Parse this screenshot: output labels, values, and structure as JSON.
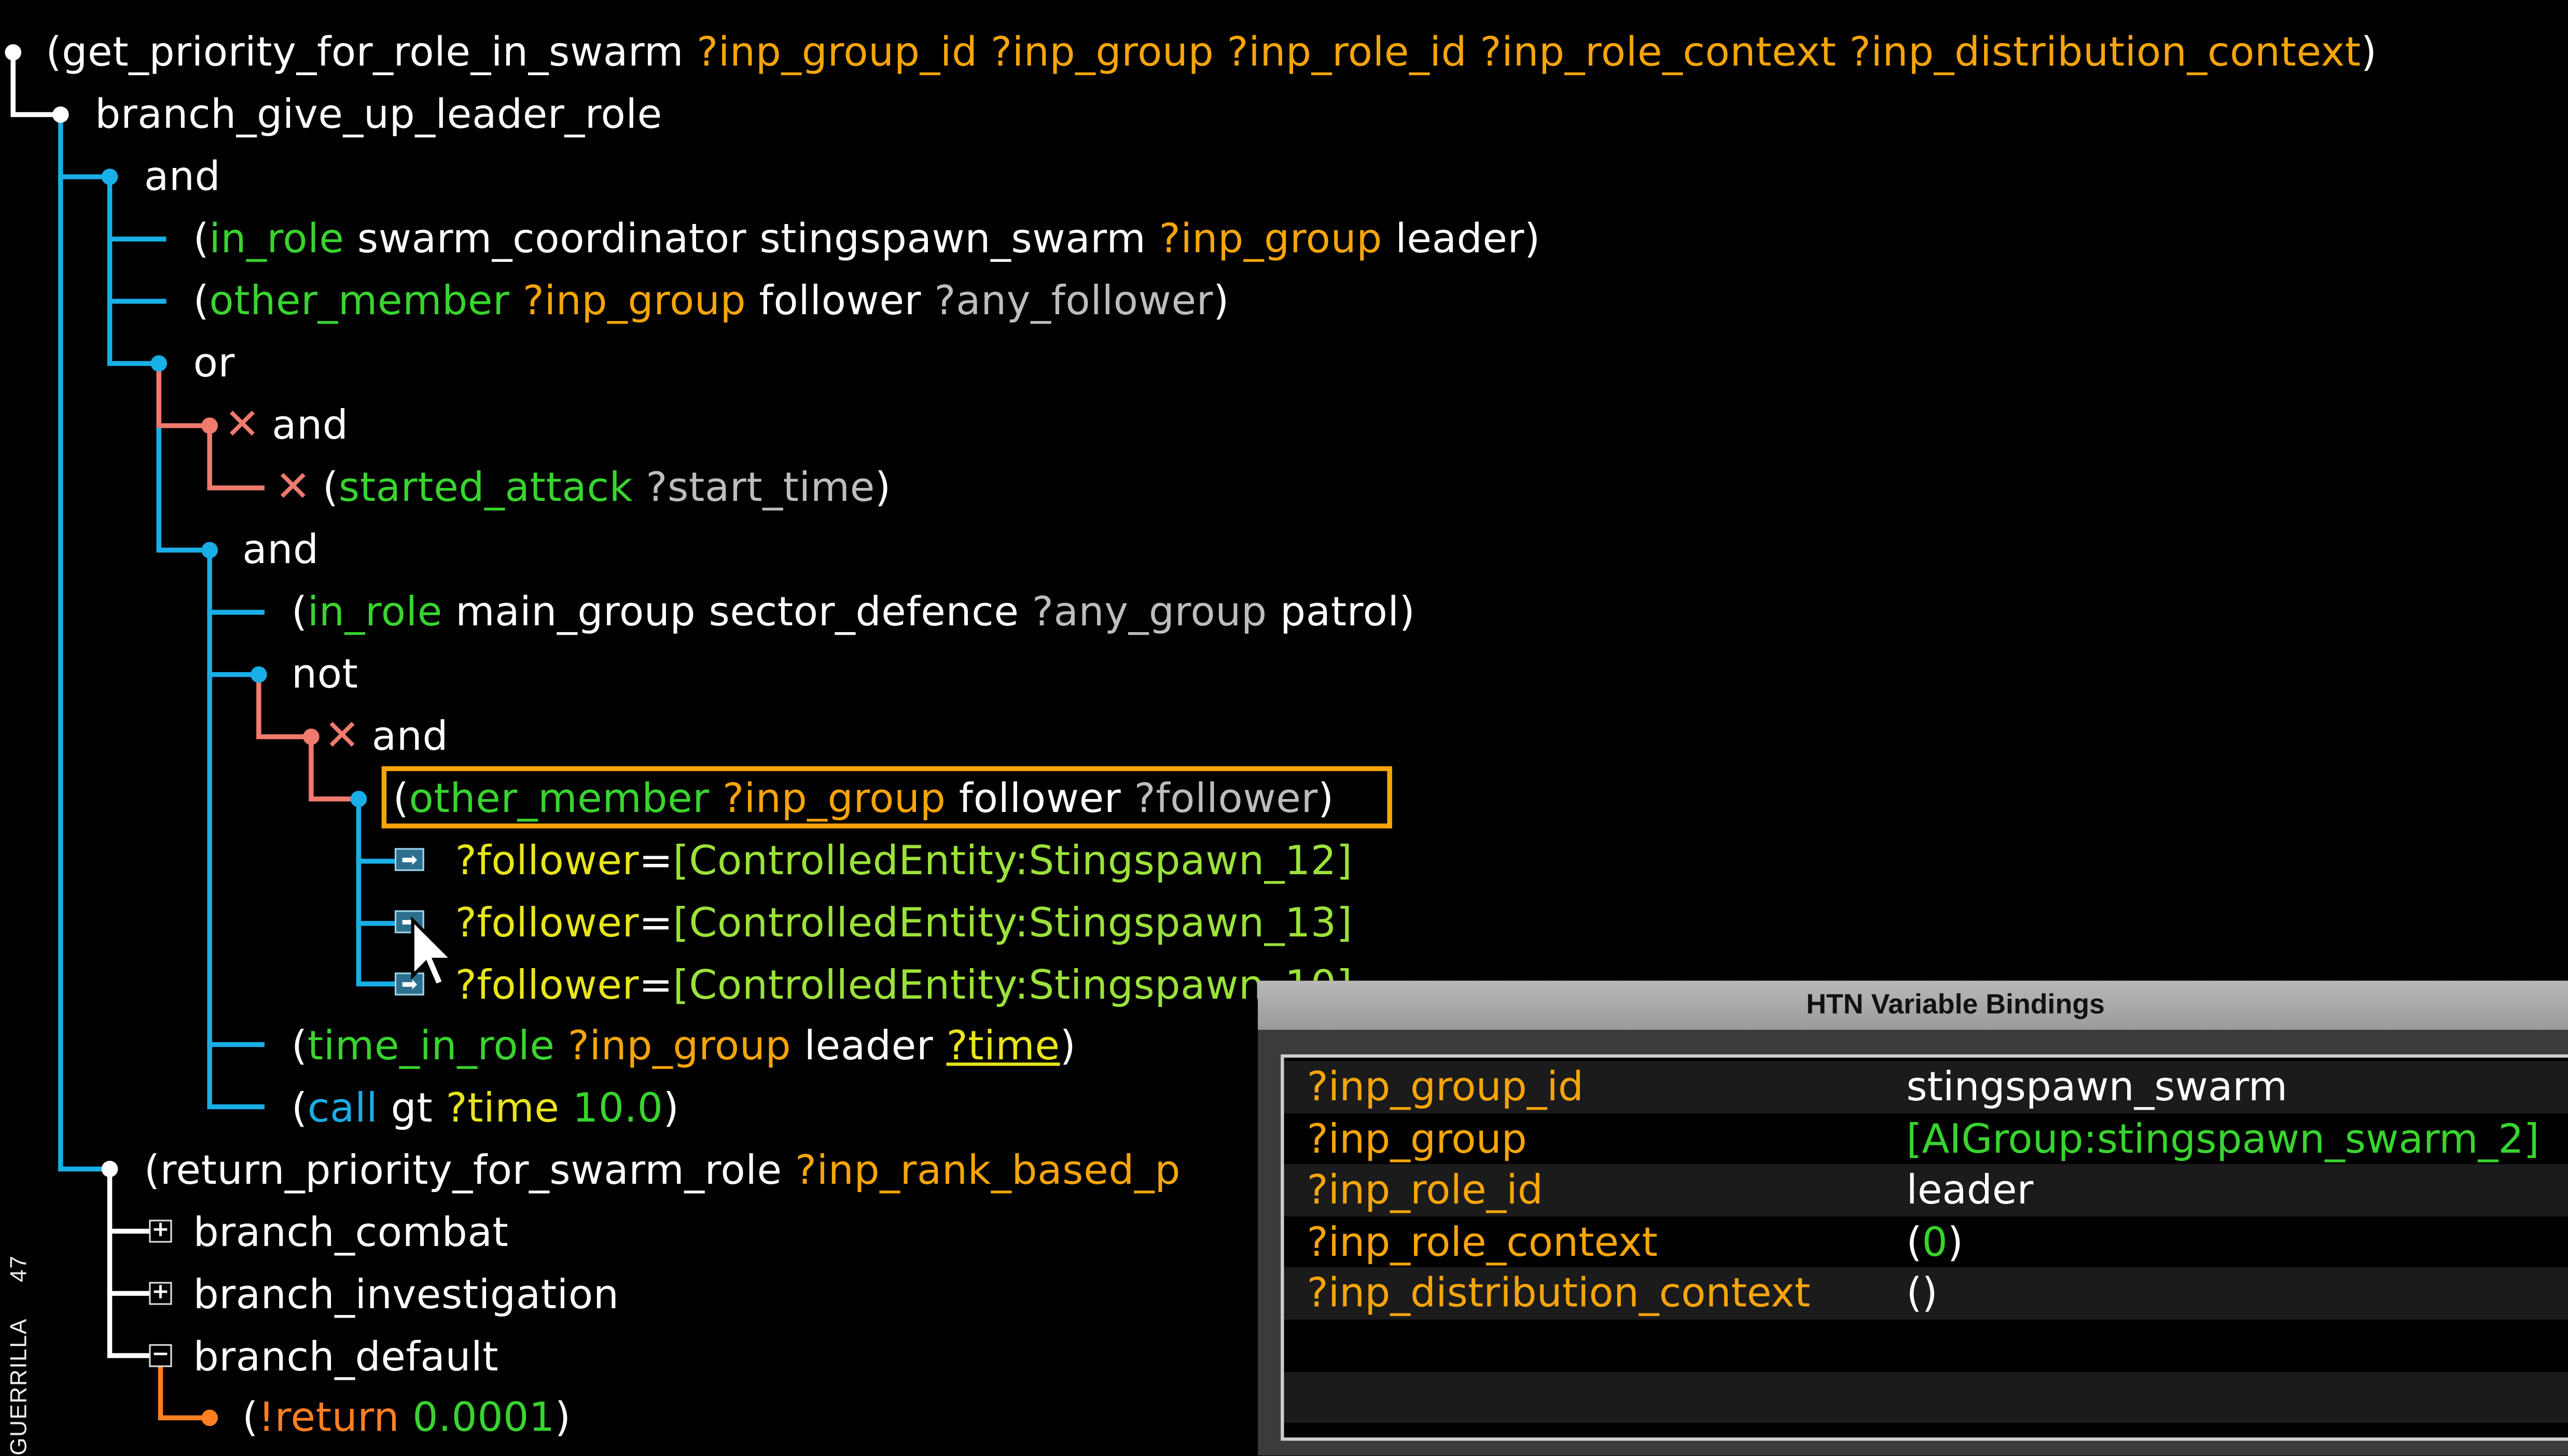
{
  "colors": {
    "background": "#000000",
    "tree_line_primary": "#1aaee6",
    "tree_line_failed": "#f07a6e",
    "tree_line_return": "#ff7f22",
    "predicate": "#39d42f",
    "variable": "#f6a50a",
    "highlight_border": "#f6a50a"
  },
  "tree": {
    "root": {
      "open": "(",
      "name": "get_priority_for_role_in_swarm",
      "args": "?inp_group_id ?inp_group ?inp_role_id ?inp_role_context ?inp_distribution_context",
      "close": ")"
    },
    "branch_give_up": "branch_give_up_leader_role",
    "and1": "and",
    "c1": {
      "open": "(",
      "pred": "in_role",
      "a": "swarm_coordinator stingspawn_swarm",
      "v": "?inp_group",
      "b": "leader",
      "close": ")"
    },
    "c2": {
      "open": "(",
      "pred": "other_member",
      "v": "?inp_group",
      "a": "follower",
      "g": "?any_follower",
      "close": ")"
    },
    "or": "or",
    "and_failed": "and",
    "c3": {
      "open": "(",
      "pred": "started_attack",
      "g": "?start_time",
      "close": ")"
    },
    "and2": "and",
    "c4": {
      "open": "(",
      "pred": "in_role",
      "a": "main_group sector_defence",
      "g": "?any_group",
      "b": "patrol",
      "close": ")"
    },
    "not": "not",
    "and3": "and",
    "c5": {
      "open": "(",
      "pred": "other_member",
      "v": "?inp_group",
      "a": "follower",
      "g": "?follower",
      "close": ")"
    },
    "bindings": [
      {
        "name": "?follower",
        "eq": "=",
        "value": "[ControlledEntity:Stingspawn_12]"
      },
      {
        "name": "?follower",
        "eq": "=",
        "value": "[ControlledEntity:Stingspawn_13]"
      },
      {
        "name": "?follower",
        "eq": "=",
        "value": "[ControlledEntity:Stingspawn_10]"
      }
    ],
    "c6": {
      "open": "(",
      "pred": "time_in_role",
      "v": "?inp_group",
      "a": "leader",
      "v2": "?time",
      "close": ")"
    },
    "c7": {
      "open": "(",
      "pred": "call",
      "a": "gt",
      "y": "?time",
      "n": "10.0",
      "close": ")"
    },
    "c8": {
      "open": "(",
      "name": "return_priority_for_swarm_role",
      "v": "?inp_rank_based_p"
    },
    "branch_combat": "branch_combat",
    "branch_investigation": "branch_investigation",
    "branch_default": "branch_default",
    "ret": {
      "open": "(",
      "name": "!return",
      "n": "0.0001",
      "close": ")"
    },
    "expand_glyph": "+",
    "collapse_glyph": "−",
    "fail_glyph": "✕",
    "bind_arrow_glyph": "➡"
  },
  "panel": {
    "title": "HTN Variable Bindings",
    "rows": [
      {
        "name": "?inp_group_id",
        "value": "stingspawn_swarm"
      },
      {
        "name": "?inp_group",
        "value": "[AIGroup:stingspawn_swarm_2]"
      },
      {
        "name": "?inp_role_id",
        "value": "leader"
      },
      {
        "name": "?inp_role_context",
        "value_open": "(",
        "value_num": "0",
        "value_close": ")"
      },
      {
        "name": "?inp_distribution_context",
        "value": "()"
      }
    ]
  },
  "side_label": {
    "brand": "GUERRILLA",
    "page": "47"
  }
}
